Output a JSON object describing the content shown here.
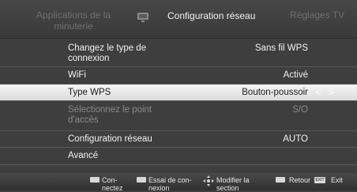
{
  "header": {
    "tab_left": "Applications de la minuterie",
    "tab_center": "Configuration réseau",
    "tab_right": "Réglages TV",
    "center_icon": "tv-settings-icon"
  },
  "menu": {
    "rows": [
      {
        "label": "Changez le type de connexion",
        "value": "Sans fil WPS",
        "state": "normal"
      },
      {
        "label": "WiFi",
        "value": "Activé",
        "state": "normal"
      },
      {
        "label": "Type WPS",
        "value": "Bouton-poussoir",
        "state": "selected"
      },
      {
        "label": "Sélectionnez le point d'accès",
        "value": "S/O",
        "state": "dim"
      },
      {
        "label": "Configuration réseau",
        "value": "AUTO",
        "state": "normal"
      },
      {
        "label": "Avancé",
        "value": "",
        "state": "normal"
      }
    ],
    "selected_arrows": "< >"
  },
  "footer": {
    "item1": "Con-nectez",
    "item2": "Essai de con-nexion",
    "item3": "Modifier la section",
    "item4": "Retour",
    "item5": "Exit",
    "exit_key": "EXIT"
  },
  "colors": {
    "background": "#3e3e3e",
    "selected_row": "#e8e8e8",
    "dim_text": "#8a8a8a"
  }
}
